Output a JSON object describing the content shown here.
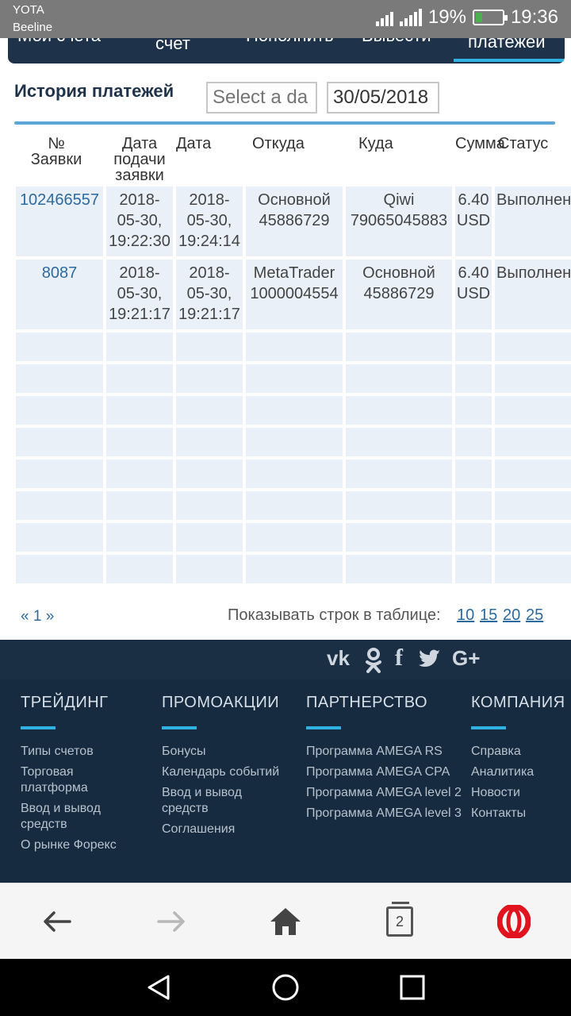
{
  "status_bar": {
    "carrier1": "YOTA",
    "carrier2": "Beeline",
    "battery": "19%",
    "time": "19:36"
  },
  "top_nav": {
    "partial_left": "Мои счета",
    "tab_account": "счет",
    "partial_deposit": "Пополнить",
    "partial_withdraw": "Вывести",
    "tab_active": "платежей"
  },
  "page": {
    "title": "История платежей",
    "date_from_placeholder": "Select a da",
    "date_to_value": "30/05/2018"
  },
  "table": {
    "headers": {
      "id": "№ Заявки",
      "submit_date": "Дата подачи заявки",
      "date": "Дата",
      "from": "Откуда",
      "to": "Куда",
      "amount": "Сумма",
      "status": "Статус"
    },
    "rows": [
      {
        "id": "102466557",
        "submit_date": [
          "2018-",
          "05-30,",
          "19:22:30"
        ],
        "date": [
          "2018-",
          "05-30,",
          "19:24:14"
        ],
        "from": [
          "Основной",
          "45886729"
        ],
        "to": [
          "Qiwi",
          "79065045883"
        ],
        "amount": [
          "6.40",
          "USD"
        ],
        "status": "Выполнен"
      },
      {
        "id": "8087",
        "submit_date": [
          "2018-",
          "05-30,",
          "19:21:17"
        ],
        "date": [
          "2018-",
          "05-30,",
          "19:21:17"
        ],
        "from": [
          "MetaTrader",
          "1000004554"
        ],
        "to": [
          "Основной",
          "45886729"
        ],
        "amount": [
          "6.40",
          "USD"
        ],
        "status": "Выполнен"
      }
    ]
  },
  "pagination": {
    "pages": "« 1 »",
    "rows_label": "Показывать строк в таблице:",
    "rows_options": [
      "10",
      "15",
      "20",
      "25"
    ]
  },
  "social": [
    "vk-icon",
    "odnoklassniki-icon",
    "facebook-icon",
    "twitter-icon",
    "google-plus-icon"
  ],
  "footer": {
    "columns": [
      {
        "title": "ТРЕЙДИНГ",
        "links": [
          "Типы счетов",
          "Торговая платформа",
          "Ввод и вывод средств",
          "О рынке Форекс"
        ]
      },
      {
        "title": "ПРОМОАКЦИИ",
        "links": [
          "Бонусы",
          "Календарь событий",
          "Ввод и вывод средств",
          "Соглашения"
        ]
      },
      {
        "title": "ПАРТНЕРСТВО",
        "links": [
          "Программа AMEGA RS",
          "Программа AMEGA CPA",
          "Программа AMEGA level 2",
          "Программа AMEGA level 3"
        ]
      },
      {
        "title": "КОМПАНИЯ",
        "links": [
          "Справка",
          "Аналитика",
          "Новости",
          "Контакты"
        ]
      }
    ]
  },
  "browser": {
    "tab_count": "2",
    "accent": "#e0141e"
  }
}
